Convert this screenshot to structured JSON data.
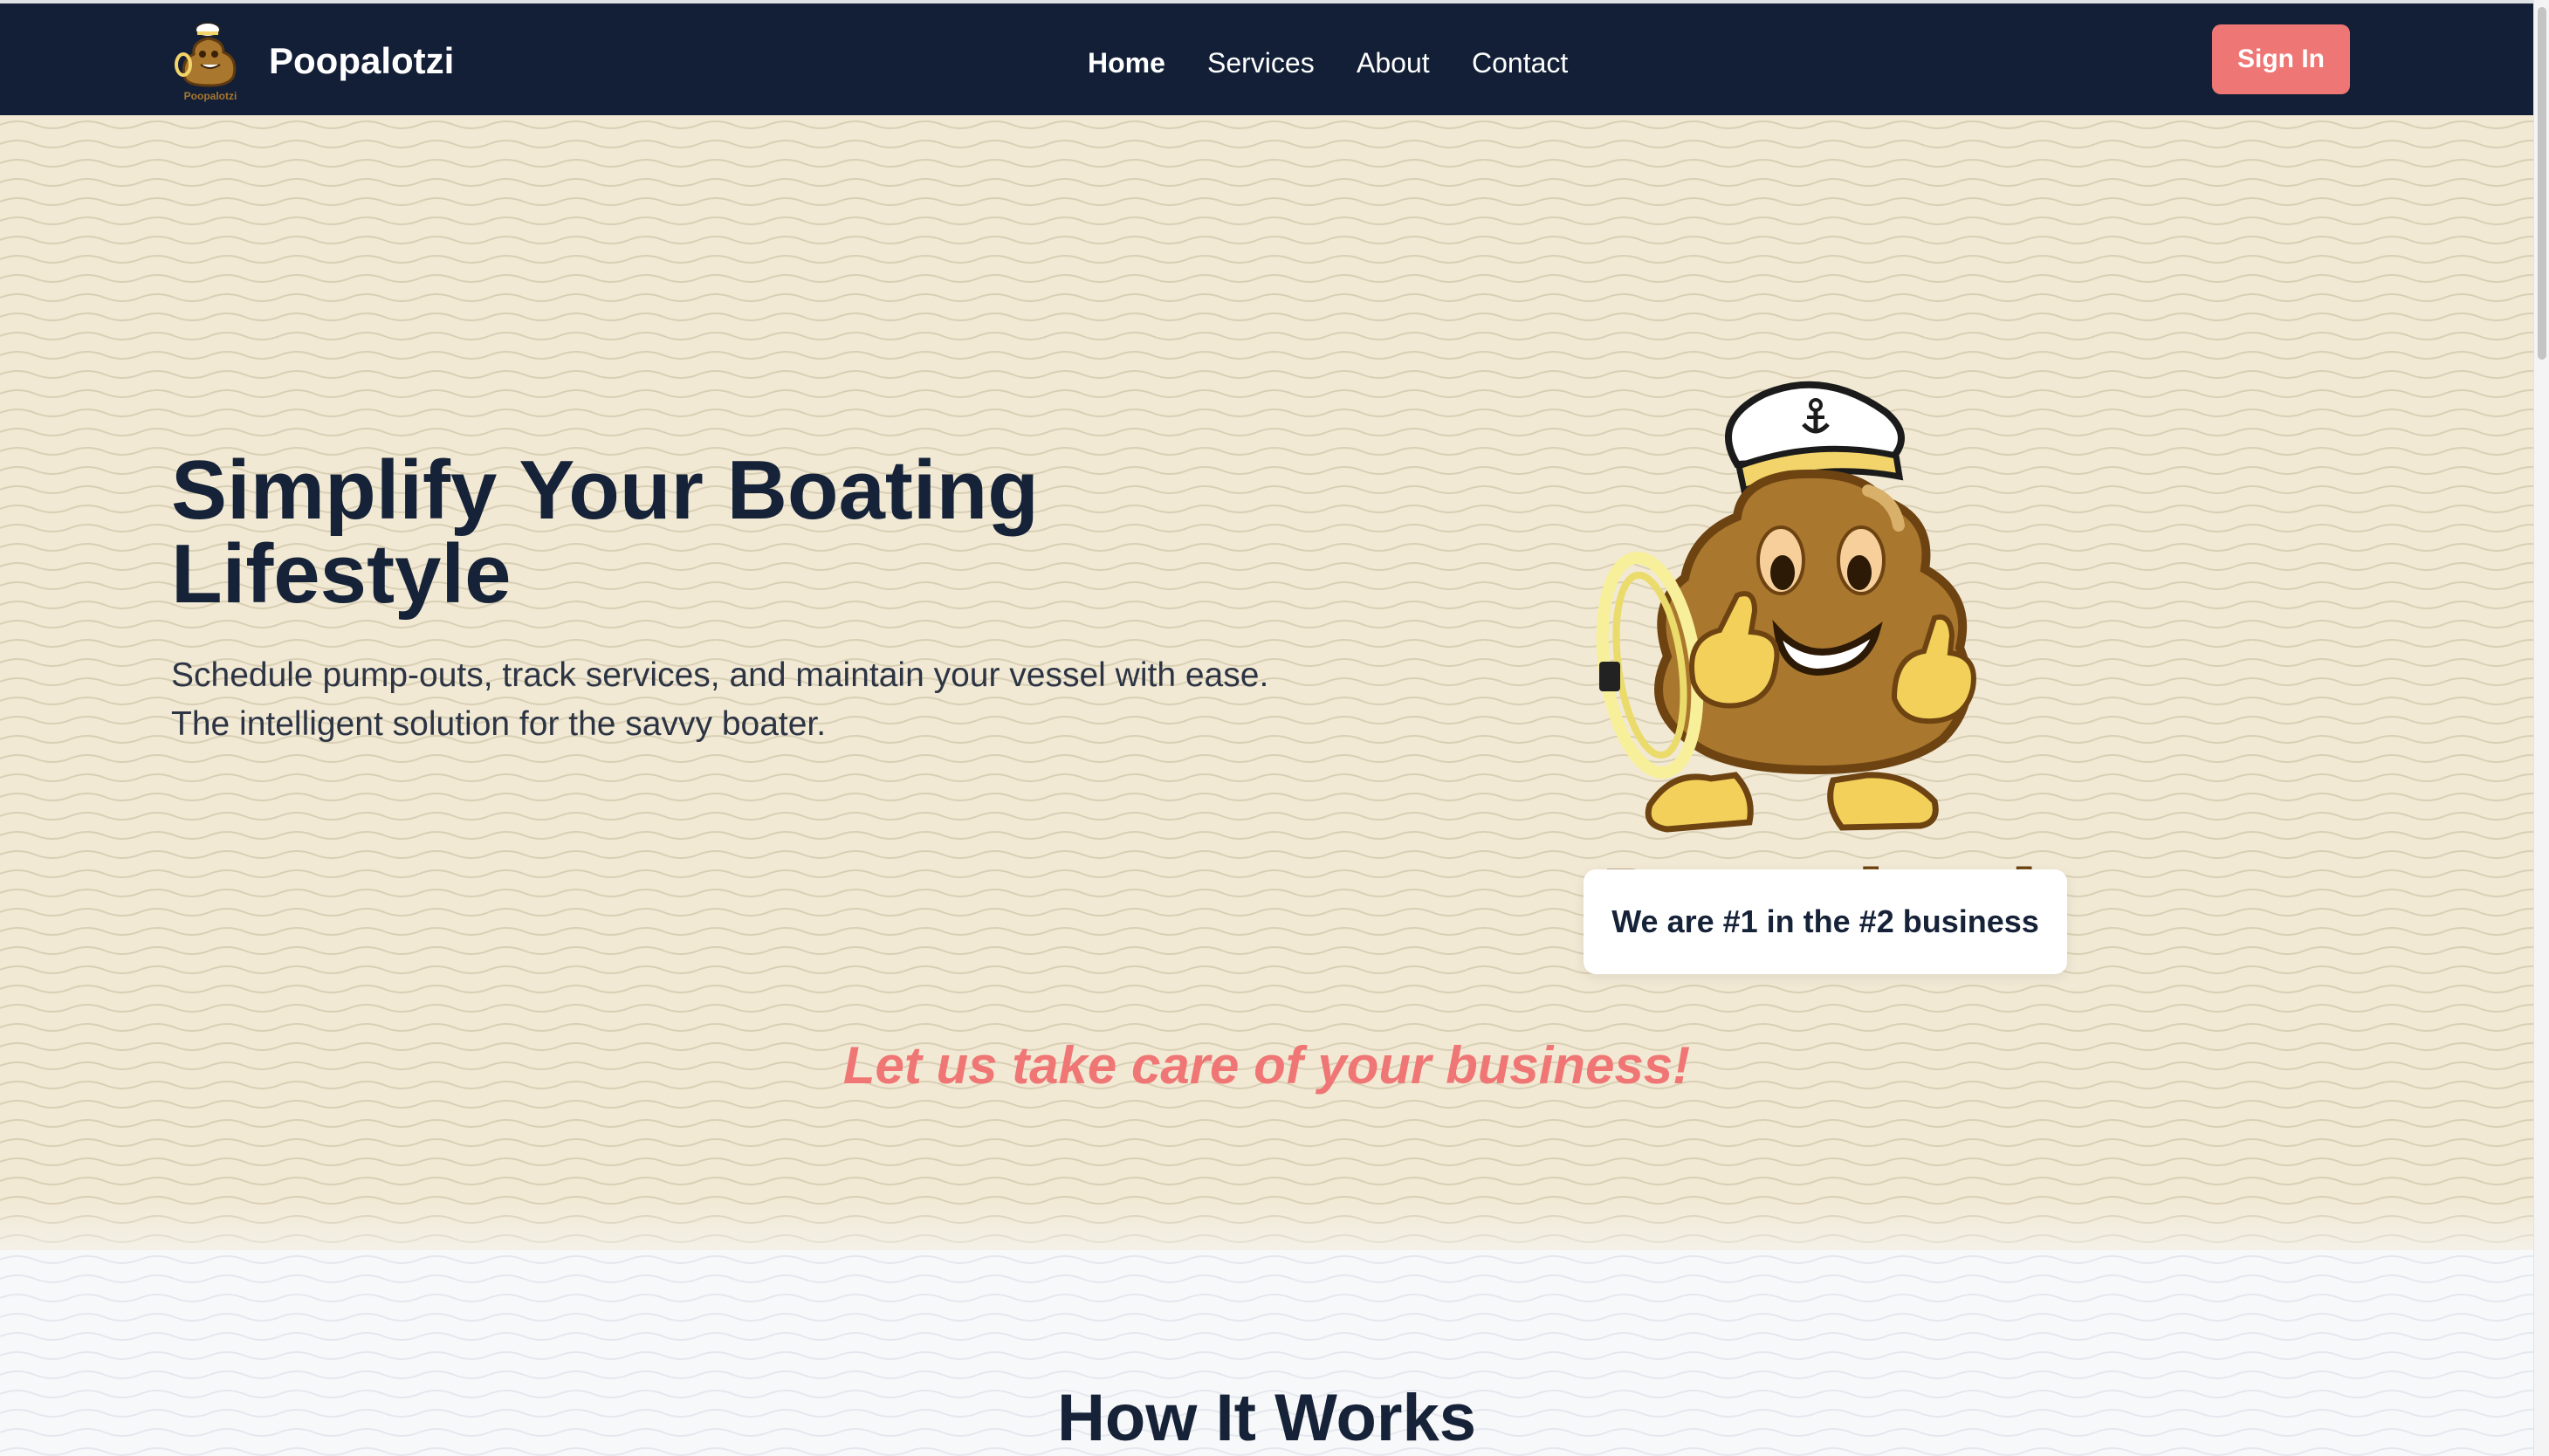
{
  "app": {
    "brand": "Poopalotzi"
  },
  "nav": {
    "items": [
      {
        "label": "Home",
        "active": true
      },
      {
        "label": "Services",
        "active": false
      },
      {
        "label": "About",
        "active": false
      },
      {
        "label": "Contact",
        "active": false
      }
    ],
    "sign_in": "Sign In"
  },
  "hero": {
    "headline": "Simplify Your Boating Lifestyle",
    "subtext": "Schedule pump-outs, track services, and maintain your vessel with ease. The intelligent solution for the savvy boater.",
    "mascot_wordmark": "Poopalotzi",
    "tagline": "We are #1 in the #2 business",
    "slogan": "Let us take care of your business!"
  },
  "how_it_works": {
    "title": "How It Works"
  },
  "colors": {
    "navbar": "#121f36",
    "accent": "#ee7674",
    "hero_bg": "#f1e9d4",
    "heading": "#152238",
    "mascot_brown": "#a9772d"
  },
  "icons": [
    "logo-mascot-icon",
    "mascot-illustration",
    "anchor-icon"
  ]
}
